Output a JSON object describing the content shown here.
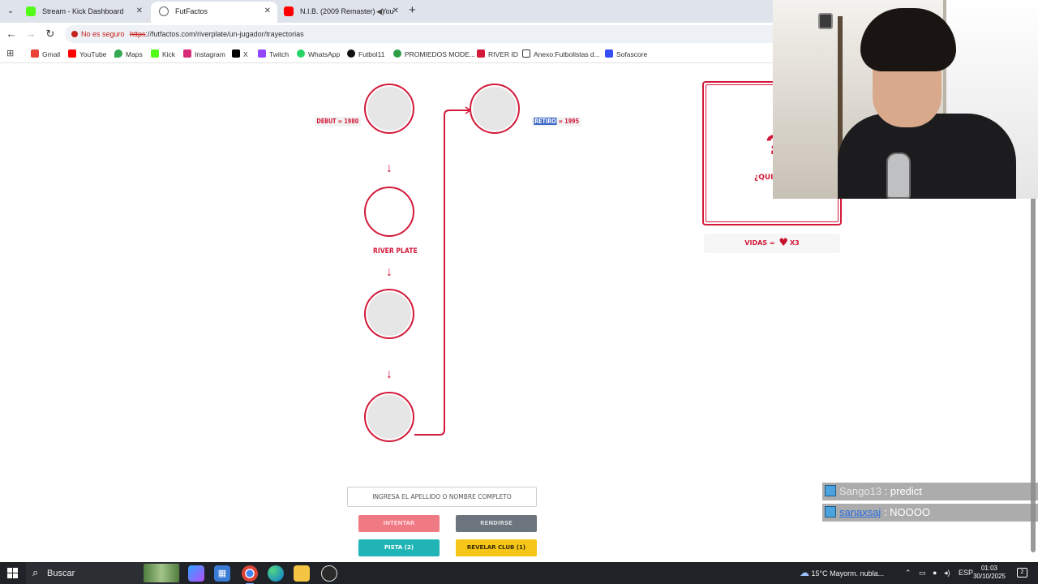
{
  "browser": {
    "tabs": [
      {
        "title": "Stream - Kick Dashboard",
        "color": "#53fc18"
      },
      {
        "title": "FutFactos",
        "color": "#5f6368"
      },
      {
        "title": "N.I.B. (2009 Remaster) - You",
        "color": "#ff0000"
      }
    ],
    "insecure_label": "No es seguro",
    "url_scheme": "https",
    "url_rest": "://futfactos.com/riverplate/un-jugador/trayectorias",
    "bookmarks": [
      {
        "label": "Gmail",
        "color": "#ea4335"
      },
      {
        "label": "YouTube",
        "color": "#ff0000"
      },
      {
        "label": "Maps",
        "color": "#34a853"
      },
      {
        "label": "Kick",
        "color": "#53fc18"
      },
      {
        "label": "Instagram",
        "color": "#d62976"
      },
      {
        "label": "X",
        "color": "#000000"
      },
      {
        "label": "Twitch",
        "color": "#9146ff"
      },
      {
        "label": "WhatsApp",
        "color": "#25d366"
      },
      {
        "label": "Futbol11",
        "color": "#111111"
      },
      {
        "label": "PROMIEDOS MODE...",
        "color": "#2e9e44"
      },
      {
        "label": "RIVER ID",
        "color": "#d31a3a"
      },
      {
        "label": "Anexo:Futbolistas d...",
        "color": "#333333"
      },
      {
        "label": "Sofascore",
        "color": "#374df5"
      }
    ]
  },
  "game": {
    "debut_label": "DEBUT = 1980",
    "retiro_word": "RETIRO",
    "retiro_value": " = 1995",
    "known_club": "RIVER PLATE",
    "mystery_mark": "?",
    "mystery_text": "¿QUIÉ",
    "lives_prefix": "VIDAS = ",
    "lives_count": "X3",
    "input_placeholder": "INGRESA EL APELLIDO O NOMBRE COMPLETO",
    "buttons": {
      "try": "INTENTAR",
      "give_up": "RENDIRSE",
      "hint": "PISTA (2)",
      "reveal": "REVELAR CLUB (1)"
    },
    "accent_color": "#d31a3a"
  },
  "chat": [
    {
      "user": "Sango13",
      "message": " : predict"
    },
    {
      "user": "sanaxsaj",
      "message": " : NOOOO"
    }
  ],
  "taskbar": {
    "search_label": "Buscar",
    "weather": "15°C  Mayorm. nubla...",
    "language": "ESP",
    "time": "01:03",
    "date": "30/10/2025",
    "notifications": "2"
  }
}
